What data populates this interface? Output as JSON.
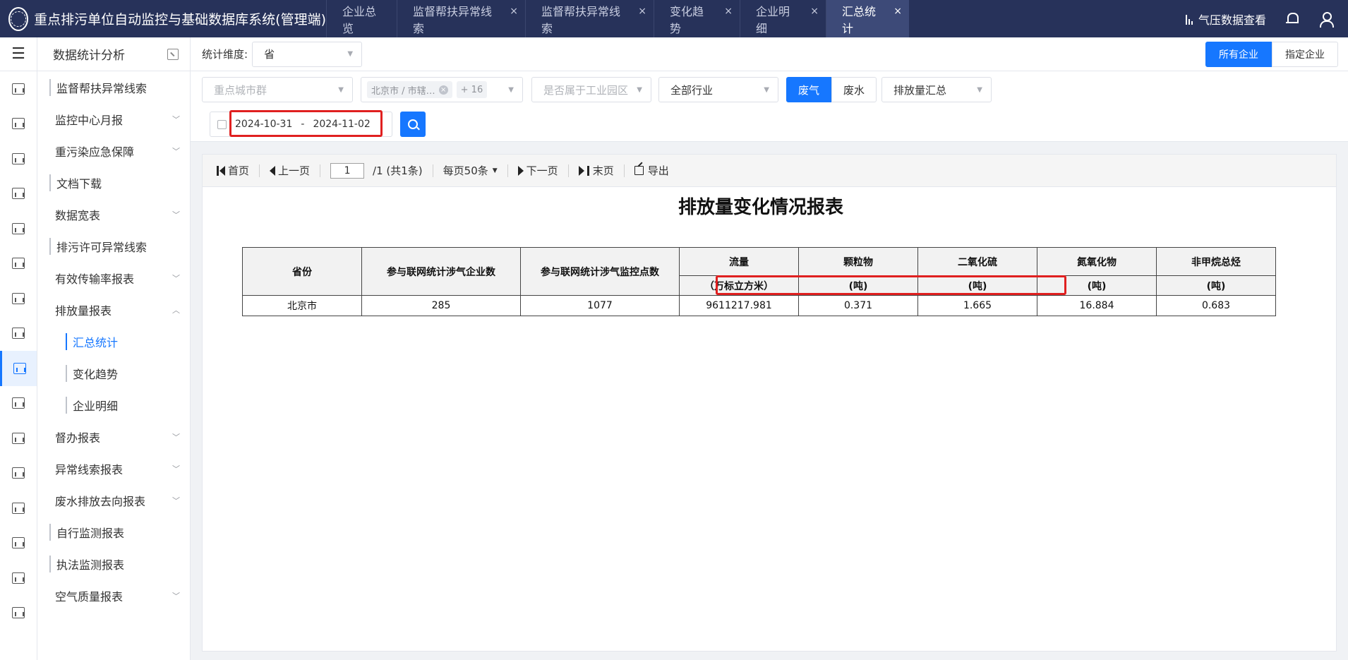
{
  "header": {
    "title": "重点排污单位自动监控与基础数据库系统(管理端)",
    "tabs": [
      {
        "label": "企业总览",
        "closable": false
      },
      {
        "label": "监督帮扶异常线索",
        "closable": true
      },
      {
        "label": "监督帮扶异常线索",
        "closable": true
      },
      {
        "label": "变化趋势",
        "closable": true
      },
      {
        "label": "企业明细",
        "closable": true
      },
      {
        "label": "汇总统计",
        "closable": true
      }
    ],
    "close_glyph": "×",
    "weather_label": "气压数据查看"
  },
  "rail": {
    "menu_glyph": "☰"
  },
  "sidebar": {
    "title": "数据统计分析",
    "items": [
      {
        "label": "监督帮扶异常线索",
        "style": "bar",
        "chevron": ""
      },
      {
        "label": "监控中心月报",
        "style": "plain",
        "chevron": "﹀"
      },
      {
        "label": "重污染应急保障",
        "style": "plain",
        "chevron": "﹀"
      },
      {
        "label": "文档下载",
        "style": "bar",
        "chevron": ""
      },
      {
        "label": "数据宽表",
        "style": "plain",
        "chevron": "﹀"
      },
      {
        "label": "排污许可异常线索",
        "style": "bar",
        "chevron": ""
      },
      {
        "label": "有效传输率报表",
        "style": "plain",
        "chevron": "﹀"
      },
      {
        "label": "排放量报表",
        "style": "plain",
        "chevron": "︿"
      },
      {
        "label": "汇总统计",
        "style": "sub-active",
        "chevron": ""
      },
      {
        "label": "变化趋势",
        "style": "sub",
        "chevron": ""
      },
      {
        "label": "企业明细",
        "style": "sub",
        "chevron": ""
      },
      {
        "label": "督办报表",
        "style": "plain",
        "chevron": "﹀"
      },
      {
        "label": "异常线索报表",
        "style": "plain",
        "chevron": "﹀"
      },
      {
        "label": "废水排放去向报表",
        "style": "plain",
        "chevron": "﹀"
      },
      {
        "label": "自行监测报表",
        "style": "bar",
        "chevron": ""
      },
      {
        "label": "执法监测报表",
        "style": "bar",
        "chevron": ""
      },
      {
        "label": "空气质量报表",
        "style": "plain",
        "chevron": "﹀"
      }
    ]
  },
  "toolbar": {
    "dimension_label": "统计维度:",
    "dimension_value": "省",
    "scope_all": "所有企业",
    "scope_selected": "指定企业"
  },
  "filters": {
    "city_group_placeholder": "重点城市群",
    "region_tag": "北京市 / 市辖…",
    "region_more": "+ 16",
    "park_placeholder": "是否属于工业园区",
    "industry": "全部行业",
    "gas": "废气",
    "water": "废水",
    "emission": "排放量汇总",
    "date_start": "2024-10-31",
    "date_sep": "-",
    "date_end": "2024-11-02"
  },
  "pager": {
    "first": "首页",
    "prev": "上一页",
    "page": "1",
    "total": "/1 (共1条)",
    "per_page": "每页50条",
    "next": "下一页",
    "last": "末页",
    "export": "导出"
  },
  "report": {
    "title": "排放量变化情况报表",
    "headers": {
      "province": "省份",
      "enterprises": "参与联网统计涉气企业数",
      "points": "参与联网统计涉气监控点数",
      "flow": "流量",
      "flow_unit": "（万标立方米）",
      "pm": "颗粒物",
      "so2": "二氧化硫",
      "nox": "氮氧化物",
      "nmhc": "非甲烷总烃",
      "ton": "(吨)"
    },
    "rows": [
      {
        "province": "北京市",
        "enterprises": "285",
        "points": "1077",
        "flow": "9611217.981",
        "pm": "0.371",
        "so2": "1.665",
        "nox": "16.884",
        "nmhc": "0.683"
      }
    ]
  }
}
